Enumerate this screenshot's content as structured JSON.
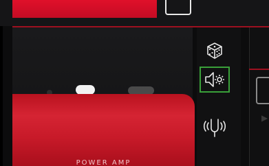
{
  "amp": {
    "label": "POWER AMP"
  },
  "toolbar": {
    "items": [
      {
        "name": "randomize",
        "icon": "dice-icon"
      },
      {
        "name": "speaker-settings",
        "icon": "speaker-gear-icon",
        "selected": true
      },
      {
        "name": "wireless",
        "icon": "pedal-wireless-icon"
      }
    ]
  },
  "colors": {
    "accent_red": "#c81a29",
    "selection_green": "#3aa23a",
    "background": "#0c0c0d"
  }
}
